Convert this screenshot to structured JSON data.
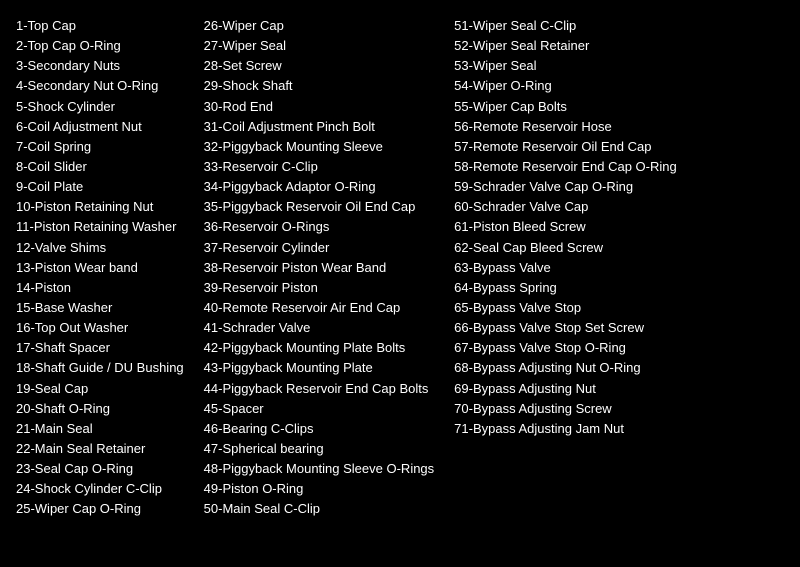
{
  "columns": [
    {
      "id": "col1",
      "items": [
        "1-Top Cap",
        "2-Top Cap O-Ring",
        "3-Secondary Nuts",
        "4-Secondary Nut O-Ring",
        "5-Shock Cylinder",
        "6-Coil Adjustment Nut",
        "7-Coil Spring",
        "8-Coil Slider",
        "9-Coil Plate",
        "10-Piston Retaining Nut",
        "11-Piston Retaining Washer",
        "12-Valve Shims",
        "13-Piston Wear band",
        "14-Piston",
        "15-Base Washer",
        "16-Top Out Washer",
        "17-Shaft Spacer",
        "18-Shaft Guide / DU Bushing",
        "19-Seal Cap",
        "20-Shaft O-Ring",
        "21-Main Seal",
        "22-Main Seal Retainer",
        "23-Seal Cap O-Ring",
        "24-Shock Cylinder C-Clip",
        "25-Wiper Cap O-Ring"
      ]
    },
    {
      "id": "col2",
      "items": [
        "26-Wiper Cap",
        "27-Wiper Seal",
        "28-Set Screw",
        "29-Shock Shaft",
        "30-Rod End",
        "31-Coil Adjustment Pinch Bolt",
        "32-Piggyback Mounting Sleeve",
        "33-Reservoir C-Clip",
        "34-Piggyback Adaptor O-Ring",
        "35-Piggyback Reservoir Oil End Cap",
        "36-Reservoir O-Rings",
        "37-Reservoir Cylinder",
        "38-Reservoir Piston Wear Band",
        "39-Reservoir Piston",
        "40-Remote Reservoir Air End Cap",
        "41-Schrader Valve",
        "42-Piggyback Mounting Plate Bolts",
        "43-Piggyback Mounting Plate",
        "44-Piggyback Reservoir End Cap Bolts",
        "45-Spacer",
        "46-Bearing C-Clips",
        "47-Spherical bearing",
        "48-Piggyback Mounting Sleeve O-Rings",
        "49-Piston O-Ring",
        "50-Main Seal C-Clip"
      ]
    },
    {
      "id": "col3",
      "items": [
        "51-Wiper Seal C-Clip",
        "52-Wiper Seal Retainer",
        "53-Wiper Seal",
        "54-Wiper O-Ring",
        "55-Wiper Cap Bolts",
        "56-Remote Reservoir Hose",
        "57-Remote Reservoir Oil End Cap",
        "58-Remote Reservoir End Cap O-Ring",
        "59-Schrader Valve Cap O-Ring",
        "60-Schrader Valve Cap",
        "61-Piston Bleed Screw",
        "62-Seal Cap Bleed Screw",
        "63-Bypass Valve",
        "64-Bypass Spring",
        "65-Bypass Valve Stop",
        "66-Bypass Valve Stop Set Screw",
        "67-Bypass Valve Stop O-Ring",
        "68-Bypass Adjusting Nut O-Ring",
        "69-Bypass Adjusting Nut",
        "70-Bypass Adjusting Screw",
        "71-Bypass Adjusting Jam Nut"
      ]
    }
  ]
}
